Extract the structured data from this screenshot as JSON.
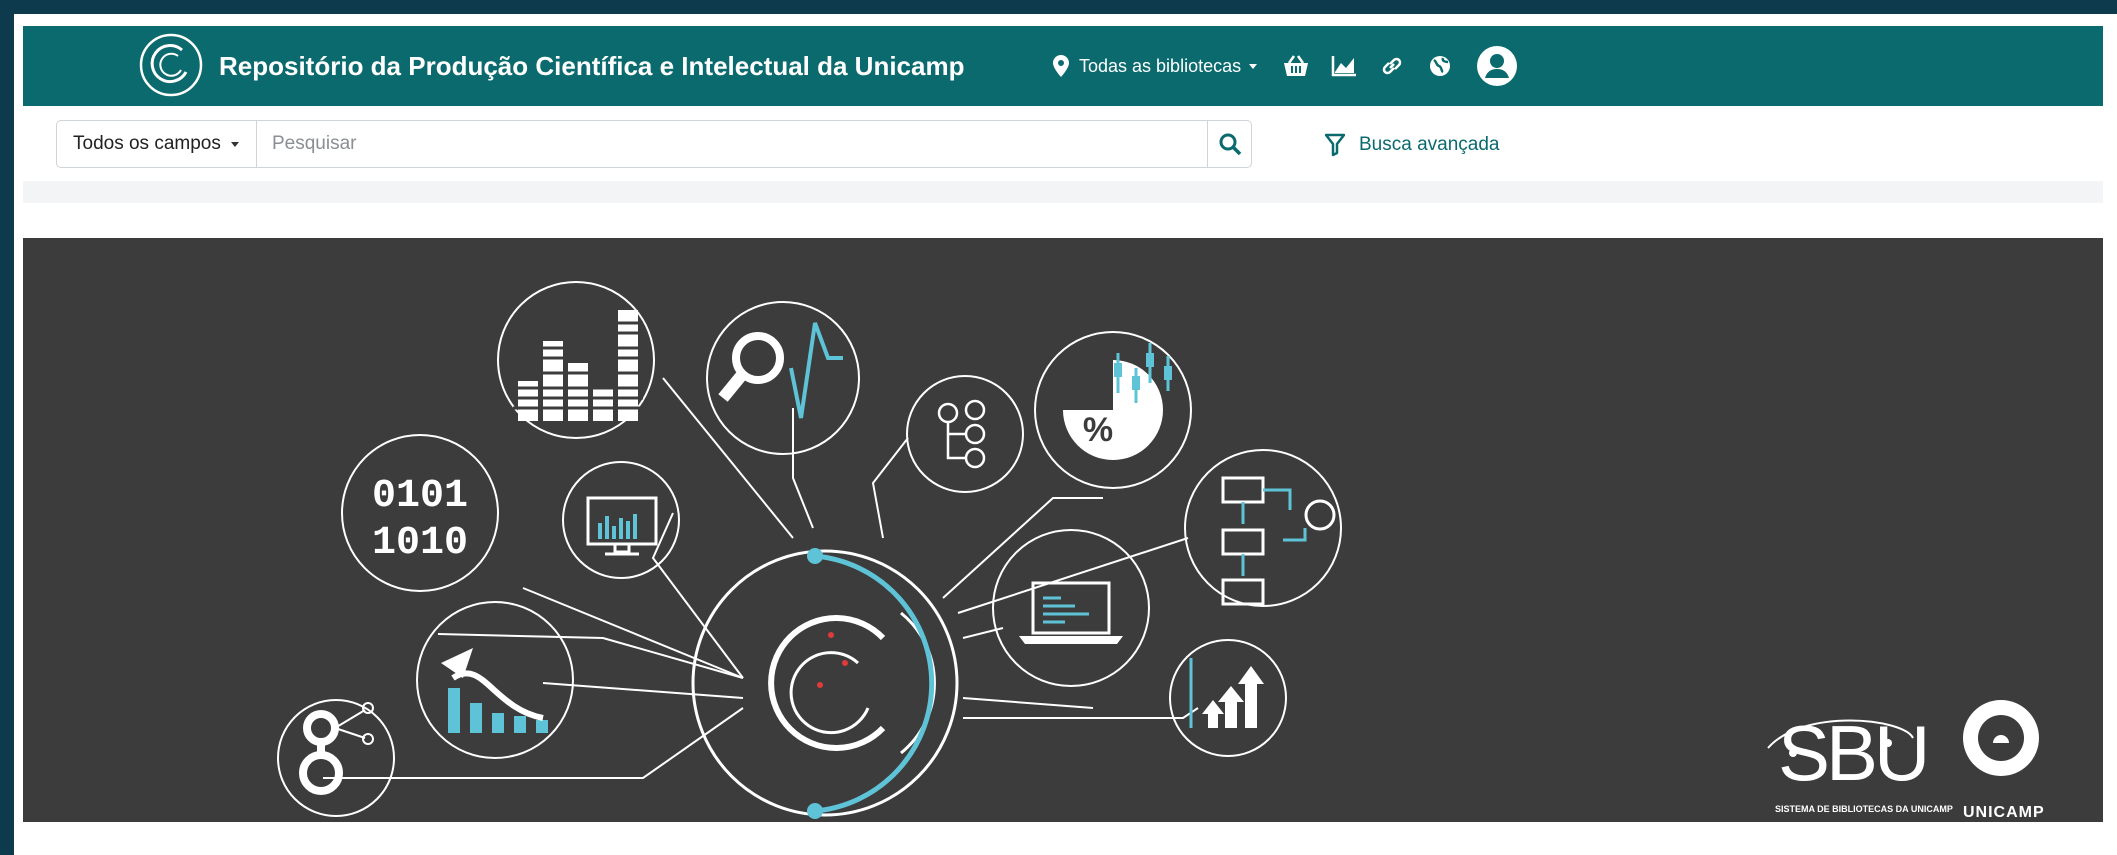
{
  "header": {
    "site_title": "Repositório da Produção Científica e Intelectual da Unicamp",
    "library_selector": "Todas as bibliotecas",
    "icons": [
      "map-marker-icon",
      "basket-icon",
      "chart-line-icon",
      "link-icon",
      "globe-icon",
      "user-avatar-icon"
    ]
  },
  "search": {
    "field_selector": "Todos os campos",
    "placeholder": "Pesquisar",
    "advanced_label": "Busca avançada"
  },
  "hero": {
    "binary_text_top": "0101",
    "binary_text_bottom": "1010",
    "percent_text": "%",
    "sbu_logo_word": "SBU",
    "sbu_logo_subtitle": "SISTEMA DE BIBLIOTECAS DA UNICAMP",
    "unicamp_logo_word": "UNICAMP"
  },
  "colors": {
    "page_frame": "#0d3a4d",
    "header_bg": "#0b6a6e",
    "hero_bg": "#3c3c3c",
    "accent_cyan": "#5fc3d8"
  }
}
